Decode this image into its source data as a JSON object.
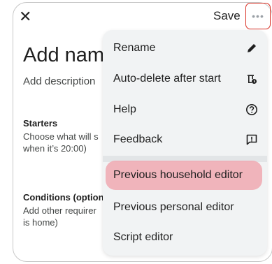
{
  "header": {
    "close_icon": "close-icon",
    "save_label": "Save",
    "more_icon": "more-horizontal-icon"
  },
  "editor": {
    "title": "Add name",
    "description_placeholder": "Add description",
    "starters": {
      "heading": "Starters",
      "body_line1": "Choose what will s",
      "body_line2": "when it’s 20:00)"
    },
    "conditions": {
      "heading": "Conditions (option",
      "body_line1": "Add other requirer",
      "body_line2": "is home)"
    }
  },
  "menu": {
    "items": [
      {
        "label": "Rename",
        "icon": "pencil-icon"
      },
      {
        "label": "Auto-delete after start",
        "icon": "auto-delete-icon"
      },
      {
        "label": "Help",
        "icon": "help-circle-icon"
      },
      {
        "label": "Feedback",
        "icon": "feedback-icon"
      },
      {
        "label": "Previous household editor",
        "icon": ""
      },
      {
        "label": "Previous personal editor",
        "icon": ""
      },
      {
        "label": "Script editor",
        "icon": ""
      }
    ]
  },
  "colors": {
    "highlight": "#f0a8b0",
    "focus_outline": "#d93025",
    "menu_background": "#f1f3f4"
  }
}
